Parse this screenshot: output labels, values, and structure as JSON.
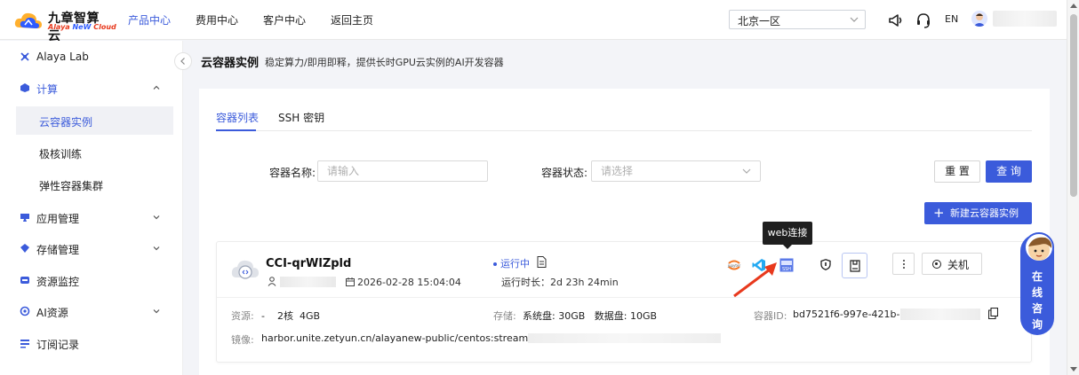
{
  "header": {
    "logo_cn": "九章智算云",
    "logo_en_1": "Alaya ",
    "logo_en_2": "NeW",
    "logo_en_3": " Cloud",
    "nav": [
      "产品中心",
      "费用中心",
      "客户中心",
      "返回主页"
    ],
    "active_nav": "产品中心",
    "region": "北京一区",
    "lang": "EN"
  },
  "sidebar": {
    "items": [
      {
        "label": "Alaya Lab",
        "icon": "lab-icon"
      },
      {
        "label": "计算",
        "icon": "compute-icon"
      },
      {
        "label": "应用管理",
        "icon": "app-icon"
      },
      {
        "label": "存储管理",
        "icon": "storage-icon"
      },
      {
        "label": "资源监控",
        "icon": "monitor-icon"
      },
      {
        "label": "AI资源",
        "icon": "ai-icon"
      },
      {
        "label": "订阅记录",
        "icon": "subscription-icon"
      }
    ],
    "compute_children": [
      "云容器实例",
      "极核训练",
      "弹性容器集群"
    ],
    "active_child": "云容器实例"
  },
  "page": {
    "title": "云容器实例",
    "subtitle": "稳定算力/即用即释，提供长时GPU云实例的AI开发容器"
  },
  "tabs": [
    "容器列表",
    "SSH 密钥"
  ],
  "filters": {
    "name_label": "容器名称:",
    "name_placeholder": "请输入",
    "status_label": "容器状态:",
    "status_placeholder": "请选择",
    "reset": "重 置",
    "query": "查 询",
    "new_instance": "新建云容器实例"
  },
  "instance": {
    "name": "CCI-qrWlZpld",
    "created": "2026-02-28 15:04:04",
    "status": "运行中",
    "runtime": "运行时长：2d 23h 24min",
    "power_off": "关机",
    "resource_label": "资源:",
    "resource_value": "-    2核  4GB",
    "storage_label": "存储:",
    "storage_value": "系统盘: 30GB   数据盘: 10GB",
    "id_label": "容器ID:",
    "id_value": "bd7521f6-997e-421b-86",
    "image_label": "镜像:",
    "image_value": "harbor.unite.zetyun.cn/alayanew-public/centos:stream9-21b:"
  },
  "tooltip": "web连接",
  "chat": [
    "在",
    "线",
    "咨",
    "询"
  ],
  "colors": {
    "primary": "#3b5bdb",
    "tooltip_bg": "#1f1f1f",
    "arrow": "#e8391d"
  }
}
